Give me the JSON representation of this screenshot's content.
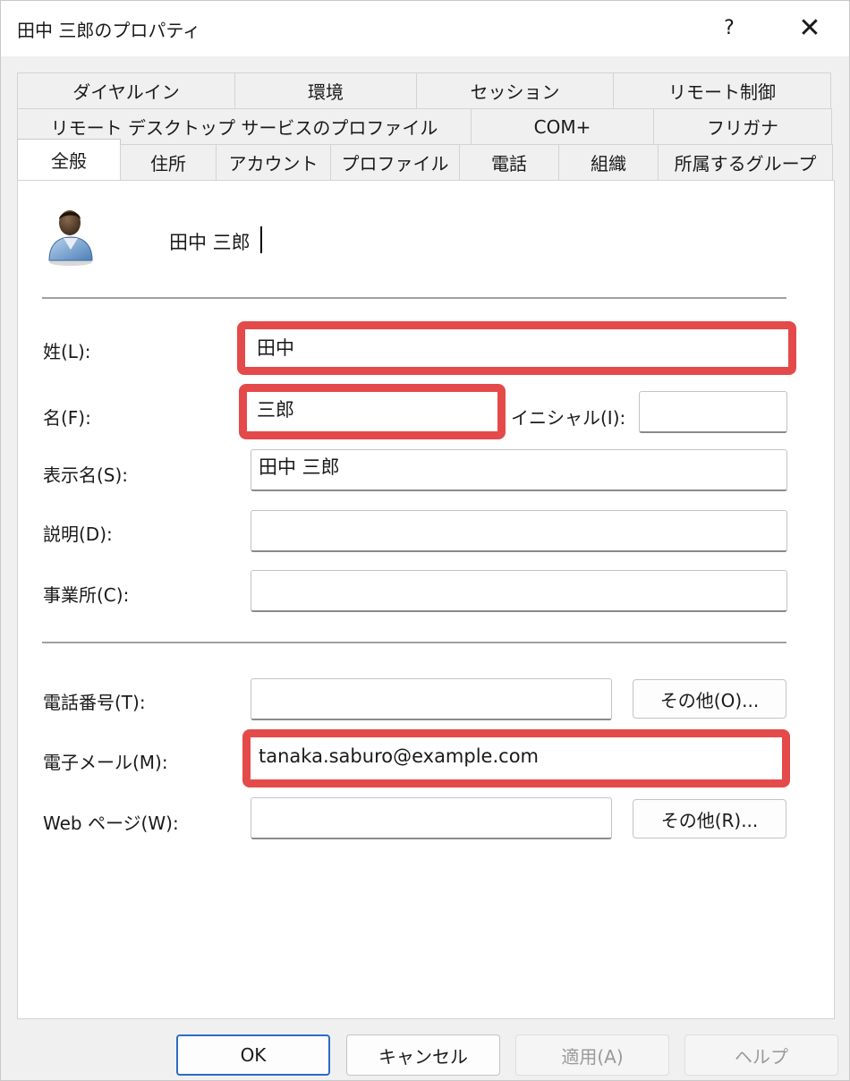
{
  "window": {
    "title": "田中 三郎のプロパティ",
    "help_label": "?",
    "close_label": "✕"
  },
  "tabs": {
    "row1": [
      "ダイヤルイン",
      "環境",
      "セッション",
      "リモート制御"
    ],
    "row2": [
      "リモート デスクトップ サービスのプロファイル",
      "COM+",
      "フリガナ"
    ],
    "row3": [
      "全般",
      "住所",
      "アカウント",
      "プロファイル",
      "電話",
      "組織",
      "所属するグループ"
    ],
    "selected": "全般"
  },
  "general": {
    "display_header": "田中 三郎",
    "avatar_icon": "user-icon",
    "last_name": {
      "label": "姓(L):",
      "value": "田中"
    },
    "first_name": {
      "label": "名(F):",
      "value": "三郎"
    },
    "initials": {
      "label": "イニシャル(I):",
      "value": ""
    },
    "display_name": {
      "label": "表示名(S):",
      "value": "田中 三郎"
    },
    "description": {
      "label": "説明(D):",
      "value": ""
    },
    "office": {
      "label": "事業所(C):",
      "value": ""
    },
    "phone": {
      "label": "電話番号(T):",
      "value": "",
      "other_label": "その他(O)..."
    },
    "email": {
      "label": "電子メール(M):",
      "value": "tanaka.saburo@example.com"
    },
    "web": {
      "label": "Web ページ(W):",
      "value": "",
      "other_label": "その他(R)..."
    }
  },
  "highlight_color": "#e44a4a",
  "footer": {
    "ok_label": "OK",
    "cancel_label": "キャンセル",
    "apply_label": "適用(A)",
    "help_label": "ヘルプ"
  }
}
